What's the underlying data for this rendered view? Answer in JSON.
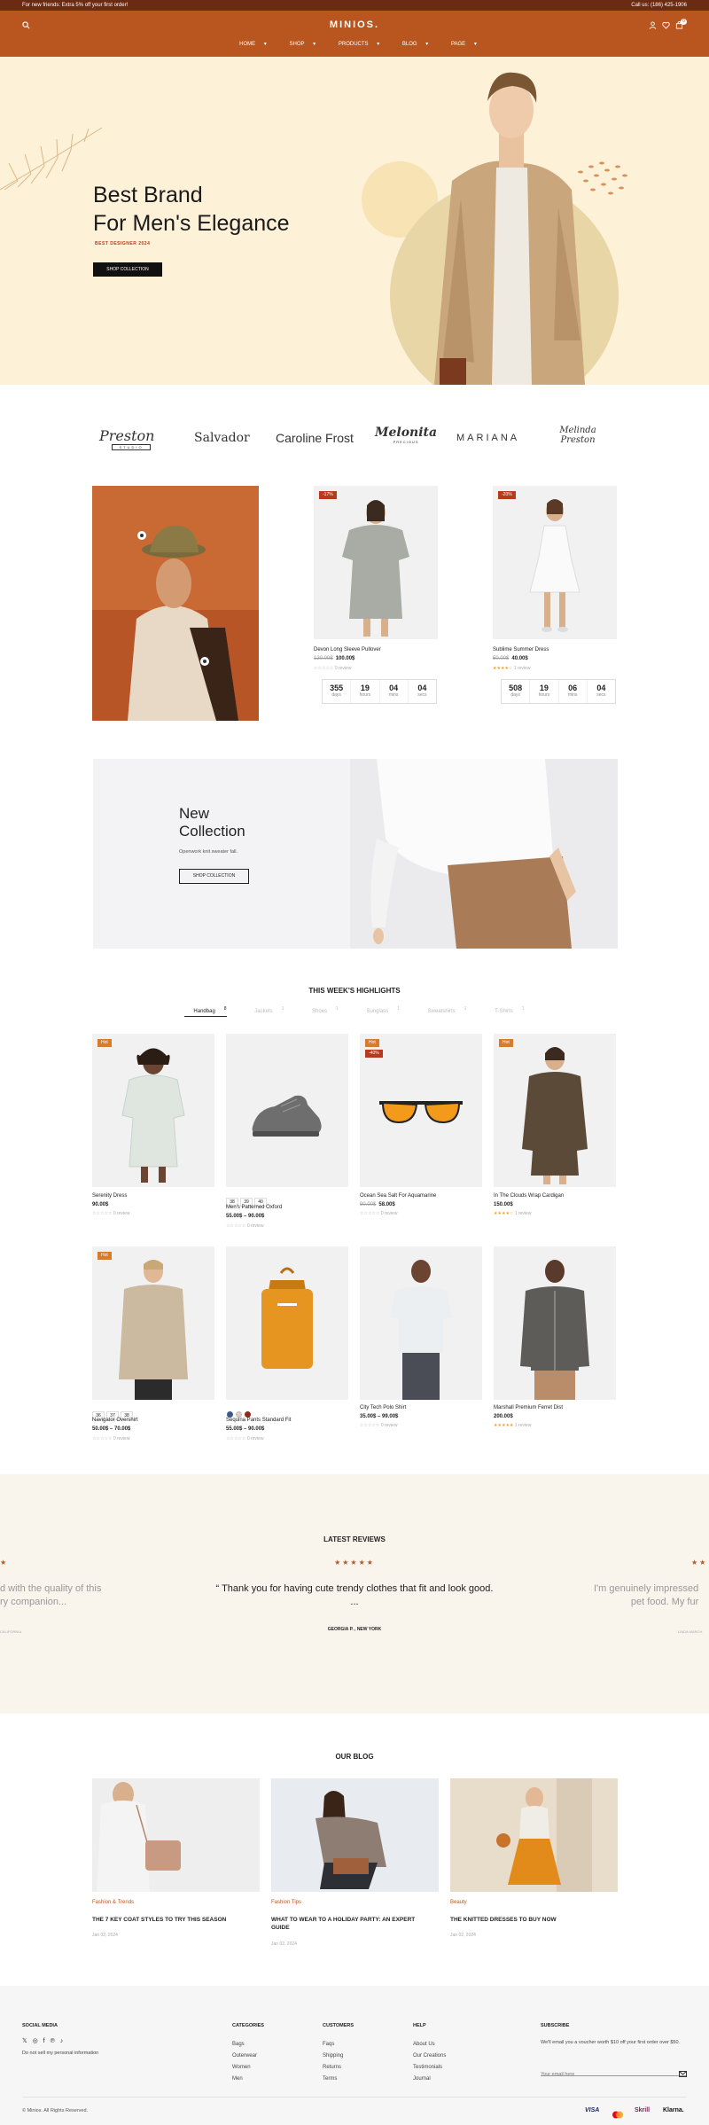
{
  "topbar": {
    "promo": "For new friends: Extra 5% off your first order!",
    "phone": "Call us: (186) 425-1906"
  },
  "header": {
    "logo": "MINIOS.",
    "cart_count": "0",
    "nav": [
      "HOME",
      "SHOP",
      "PRODUCTS",
      "BLOG",
      "PAGE"
    ]
  },
  "hero": {
    "title_line1": "Best Brand",
    "title_line2": "For Men's Elegance",
    "subtitle": "BEST DESIGNER 2024",
    "button": "SHOP COLLECTION"
  },
  "brands": [
    "Preston",
    "Salvador",
    "Caroline Frost",
    "Melonita",
    "MARIANA",
    "Melinda Preston"
  ],
  "brand_sub": {
    "preston": "STUDIO",
    "melonita": "PRECIOUS"
  },
  "deals": [
    {
      "badge": "-17%",
      "name": "Devon Long Sleeve Pullover",
      "old_price": "120.00$",
      "price": "100.00$",
      "reviews": "0 review",
      "timer": {
        "days": "355",
        "hours": "19",
        "mins": "04",
        "secs": "04"
      }
    },
    {
      "badge": "-20%",
      "name": "Sublime Summer Dress",
      "old_price": "50.00$",
      "price": "40.00$",
      "reviews": "1 review",
      "timer": {
        "days": "508",
        "hours": "19",
        "mins": "06",
        "secs": "04"
      }
    }
  ],
  "timer_units": {
    "days": "days",
    "hours": "hours",
    "mins": "mins",
    "secs": "secs"
  },
  "collection": {
    "title_line1": "New",
    "title_line2": "Collection",
    "text": "Openwork knit sweater fall.",
    "button": "SHOP COLLECTION"
  },
  "highlights": {
    "title": "THIS WEEK'S HIGHLIGHTS",
    "tabs": [
      {
        "label": "Handbag",
        "count": "8"
      },
      {
        "label": "Jackets",
        "count": "1"
      },
      {
        "label": "Shoes",
        "count": "1"
      },
      {
        "label": "Sunglass",
        "count": "1"
      },
      {
        "label": "Sweatshirts",
        "count": "1"
      },
      {
        "label": "T-Shirts",
        "count": "1"
      }
    ],
    "products": [
      {
        "name": "Serenity Dress",
        "price": "90.00$",
        "reviews": "0 review",
        "badge": "Hot"
      },
      {
        "name": "Men's Patterned Oxford",
        "price": "55.00$ – 90.00$",
        "reviews": "0 review",
        "sizes": [
          "38",
          "39",
          "40"
        ]
      },
      {
        "name": "Ocean Sea Salt For Aquamarine",
        "old_price": "90.00$",
        "price": "58.00$",
        "reviews": "0 review",
        "badge": "Hot",
        "badge2": "-40%"
      },
      {
        "name": "In The Clouds Wrap Cardigan",
        "price": "150.00$",
        "reviews": "1 review",
        "badge": "Hot"
      },
      {
        "name": "Navigator Overshirt",
        "price": "50.00$ – 70.00$",
        "reviews": "0 review",
        "badge": "Hot",
        "sizes": [
          "36",
          "37",
          "38"
        ]
      },
      {
        "name": "Sequina Pants Standard Fit",
        "price": "55.00$ – 90.00$",
        "reviews": "0 review"
      },
      {
        "name": "City Tech Polo Shirt",
        "price": "35.00$ – 99.00$",
        "reviews": "0 review"
      },
      {
        "name": "Marshall Premium Ferret Dist",
        "price": "200.00$",
        "reviews": "1 review"
      }
    ]
  },
  "reviews": {
    "title": "LATEST REVIEWS",
    "stars": "★★★★★",
    "quote": "“ Thank you for having cute trendy clothes that fit and look good. ...",
    "author": "GEORGIA P. , NEW YORK",
    "left_line1": "d with the quality of this",
    "left_line2": "ry companion...",
    "left_author": "CALIFORNIA",
    "right_line1": "I'm genuinely impressed",
    "right_line2": "pet food. My fur",
    "right_author": "LINDA MARCH"
  },
  "blog": {
    "title": "OUR BLOG",
    "posts": [
      {
        "category": "Fashion & Trends",
        "title": "THE 7 KEY COAT STYLES TO TRY THIS SEASON",
        "date": "Jan 02, 2024"
      },
      {
        "category": "Fashion Tips",
        "title": "WHAT TO WEAR TO A HOLIDAY PARTY: AN EXPERT GUIDE",
        "date": "Jan 02, 2024"
      },
      {
        "category": "Beauty",
        "title": "THE KNITTED DRESSES TO BUY NOW",
        "date": "Jan 02, 2024"
      }
    ]
  },
  "footer": {
    "social_title": "SOCIAL MEDIA",
    "privacy": "Do not sell my personal information",
    "categories_title": "CATEGORIES",
    "categories": [
      "Bags",
      "Outerwear",
      "Women",
      "Men"
    ],
    "customers_title": "CUSTOMERS",
    "customers": [
      "Faqs",
      "Shipping",
      "Returns",
      "Terms"
    ],
    "help_title": "HELP",
    "help": [
      "About Us",
      "Our Creations",
      "Testimonials",
      "Journal"
    ],
    "subscribe_title": "SUBSCRIBE",
    "subscribe_text": "We'll email you a voucher worth $10 off your first order over $50.",
    "email_placeholder": "Your email here",
    "copyright": "© Minios. All Rights Reserved.",
    "payments": [
      "VISA",
      "Skrill",
      "Klarna."
    ]
  },
  "colors": {
    "accent": "#b9561f",
    "topbar": "#6b2a12",
    "hero_bg": "#fdf1d8",
    "reviews_bg": "#f9f4ec"
  }
}
